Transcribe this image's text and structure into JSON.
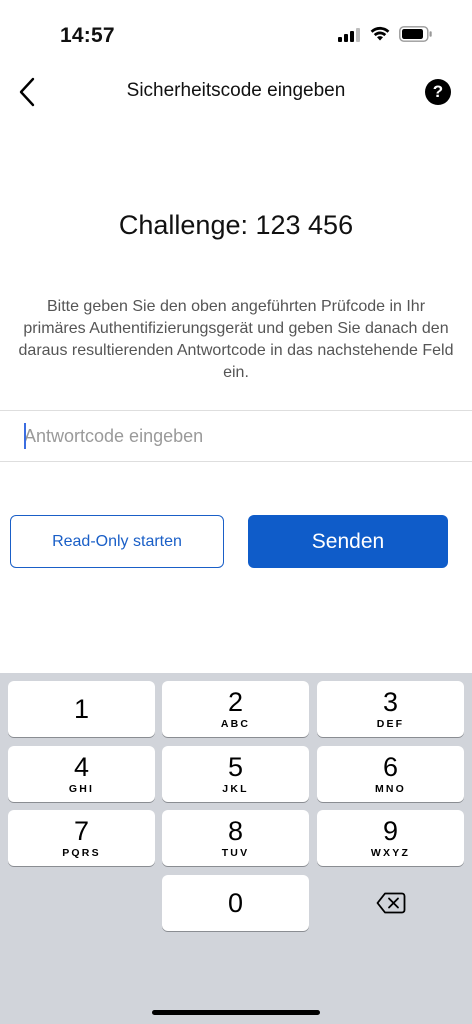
{
  "status_bar": {
    "time": "14:57"
  },
  "nav": {
    "title": "Sicherheitscode eingeben",
    "help_label": "?"
  },
  "challenge": {
    "text": "Challenge: 123 456"
  },
  "instructions": {
    "text": "Bitte geben Sie den oben angeführten Prüfcode in Ihr primäres Authentifizierungsgerät und geben Sie danach den daraus resultierenden Antwortcode in das nachstehende Feld ein."
  },
  "response_input": {
    "value": "",
    "placeholder": "Antwortcode eingeben"
  },
  "buttons": {
    "read_only": "Read-Only starten",
    "send": "Senden"
  },
  "keypad": {
    "keys": [
      {
        "num": "1",
        "letters": ""
      },
      {
        "num": "2",
        "letters": "ABC"
      },
      {
        "num": "3",
        "letters": "DEF"
      },
      {
        "num": "4",
        "letters": "GHI"
      },
      {
        "num": "5",
        "letters": "JKL"
      },
      {
        "num": "6",
        "letters": "MNO"
      },
      {
        "num": "7",
        "letters": "PQRS"
      },
      {
        "num": "8",
        "letters": "TUV"
      },
      {
        "num": "9",
        "letters": "WXYZ"
      },
      {
        "num": "0",
        "letters": ""
      }
    ],
    "delete_icon": "backspace-icon"
  },
  "colors": {
    "accent": "#0f5cc9",
    "keypad_bg": "#d1d4da"
  }
}
